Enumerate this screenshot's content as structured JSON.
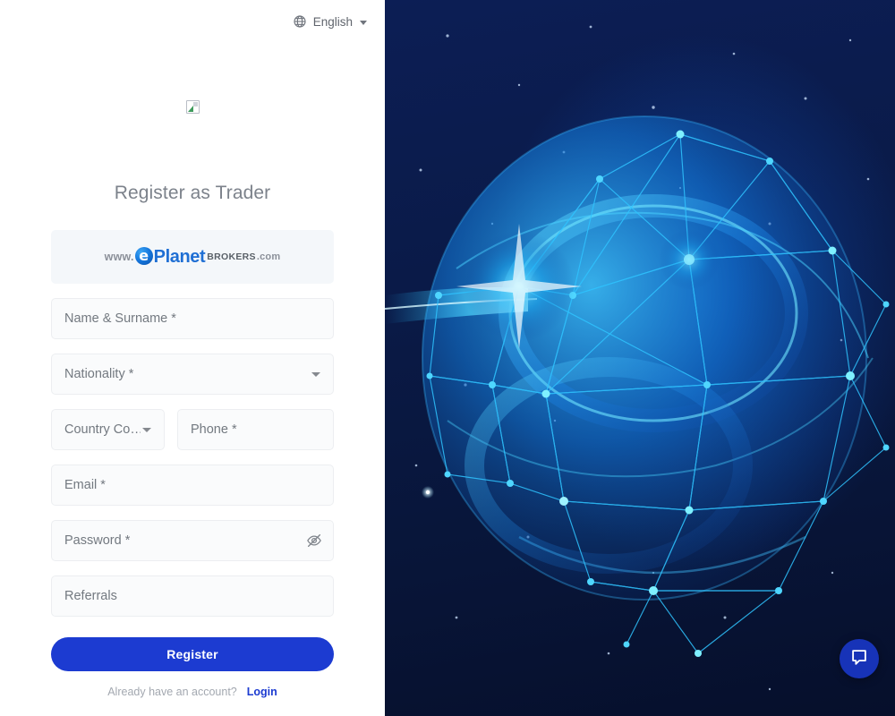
{
  "language_selector": {
    "icon": "globe-icon",
    "label": "English",
    "caret": "chevron-down-icon"
  },
  "logo": {
    "state": "broken-image-placeholder",
    "alt": ""
  },
  "page_title": "Register as Trader",
  "brand_banner": {
    "prefix": "www.",
    "mark": "e",
    "name": "Planet",
    "suffix": "BROKERS",
    "tld": ".com",
    "background": "#f4f7fa"
  },
  "form": {
    "fields": [
      {
        "name": "name-surname",
        "label": "Name & Surname *",
        "type": "text",
        "required": true,
        "value": ""
      },
      {
        "name": "nationality",
        "label": "Nationality *",
        "type": "select",
        "required": true,
        "value": ""
      },
      {
        "name": "country-code",
        "label": "Country Co…",
        "type": "select",
        "required": true,
        "value": ""
      },
      {
        "name": "phone",
        "label": "Phone *",
        "type": "tel",
        "required": true,
        "value": ""
      },
      {
        "name": "email",
        "label": "Email *",
        "type": "email",
        "required": true,
        "value": ""
      },
      {
        "name": "password",
        "label": "Password *",
        "type": "password",
        "required": true,
        "value": ""
      },
      {
        "name": "referrals",
        "label": "Referrals",
        "type": "text",
        "required": false,
        "value": ""
      }
    ],
    "password_toggle_icon": "eye-off-icon",
    "submit_label": "Register",
    "submit_color": "#1c3bd1"
  },
  "footer": {
    "prompt": "Already have an account?",
    "login_label": "Login",
    "link_color": "#1c3bd1"
  },
  "hero": {
    "description": "network-globe-illustration",
    "background_color": "#0a1a47",
    "accent_color": "#18a9f5"
  },
  "chat_widget": {
    "icon": "chat-bubble-icon",
    "color": "#1733b8"
  }
}
